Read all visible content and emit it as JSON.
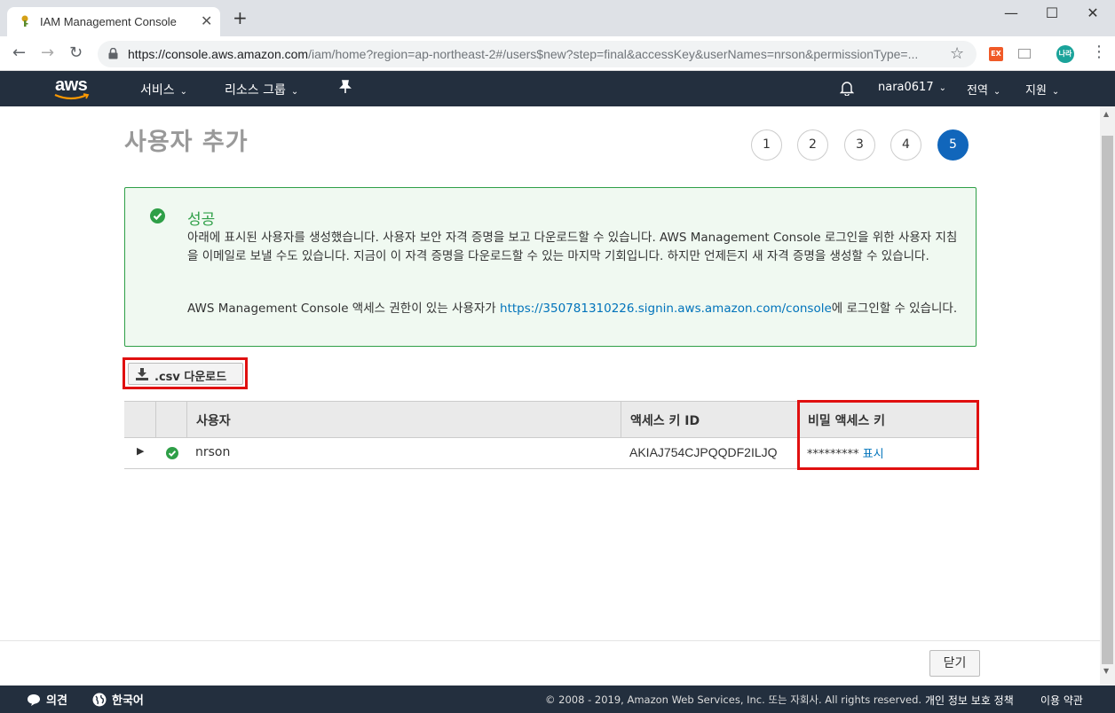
{
  "browser": {
    "tab_title": "IAM Management Console",
    "url_host": "https://console.aws.amazon.com",
    "url_path": "/iam/home?region=ap-northeast-2#/users$new?step=final&accessKey&userNames=nrson&permissionType=...",
    "extensions": [
      {
        "name": "ex-extension-icon",
        "label": "EX",
        "color": "#f05a28"
      },
      {
        "name": "profile-avatar",
        "label": "나라",
        "color": "#1aa39a"
      }
    ]
  },
  "awsnav": {
    "logo": "aws",
    "services": "서비스",
    "resource_groups": "리소스 그룹",
    "account": "nara0617",
    "region": "전역",
    "support": "지원"
  },
  "page": {
    "title": "사용자 추가",
    "steps": [
      "1",
      "2",
      "3",
      "4",
      "5"
    ],
    "active_step": "5"
  },
  "alert": {
    "title": "성공",
    "body": "아래에 표시된 사용자를 생성했습니다. 사용자 보안 자격 증명을 보고 다운로드할 수 있습니다. AWS Management Console 로그인을 위한 사용자 지침을 이메일로 보낼 수도 있습니다. 지금이 이 자격 증명을 다운로드할 수 있는 마지막 기회입니다. 하지만 언제든지 새 자격 증명을 생성할 수 있습니다.",
    "login_prefix": "AWS Management Console 액세스 권한이 있는 사용자가 ",
    "login_url": "https://350781310226.signin.aws.amazon.com/console",
    "login_suffix": "에 로그인할 수 있습니다."
  },
  "csv_button": ".csv 다운로드",
  "table": {
    "headers": [
      "사용자",
      "액세스 키 ID",
      "비밀 액세스 키"
    ],
    "rows": [
      {
        "user": "nrson",
        "access_key_id": "AKIAJ754CJPQQDF2ILJQ",
        "secret_masked": "*********",
        "show_label": "표시"
      }
    ]
  },
  "close_button": "닫기",
  "footer": {
    "feedback": "의견",
    "language": "한국어",
    "copyright": "© 2008 - 2019, Amazon Web Services, Inc. 또는 자회사. All rights reserved.",
    "privacy": "개인 정보 보호 정책",
    "terms": "이용 약관"
  },
  "colors": {
    "aws_nav": "#232f3e",
    "success": "#2e9f47",
    "link": "#0073bb",
    "active_step": "#1166bb",
    "highlight": "#e01010"
  }
}
